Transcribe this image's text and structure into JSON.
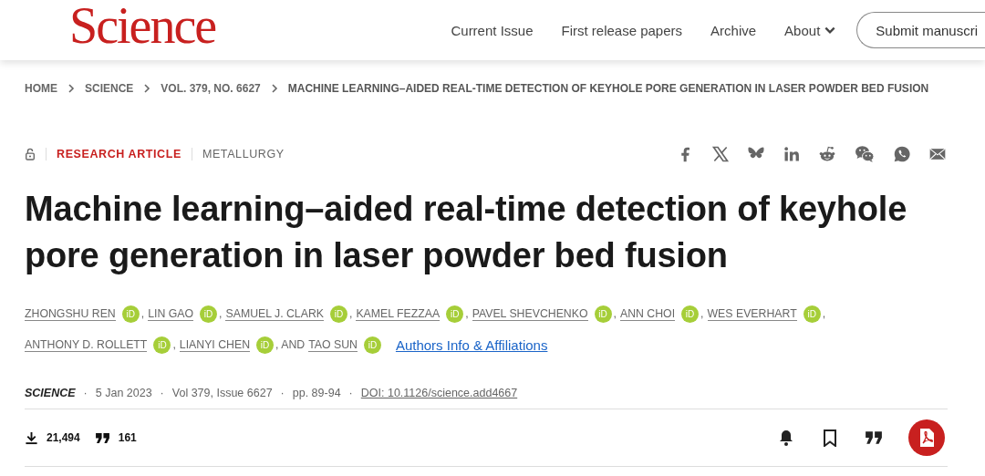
{
  "header": {
    "logo": "Science",
    "nav": [
      {
        "label": "Current Issue",
        "kind": "link"
      },
      {
        "label": "First release papers",
        "kind": "link"
      },
      {
        "label": "Archive",
        "kind": "link"
      },
      {
        "label": "About",
        "kind": "menu"
      }
    ],
    "submit_button": "Submit manuscri"
  },
  "breadcrumb": [
    "HOME",
    "SCIENCE",
    "VOL. 379, NO. 6627",
    "MACHINE LEARNING–AIDED REAL-TIME DETECTION OF KEYHOLE PORE GENERATION IN LASER POWDER BED FUSION"
  ],
  "article": {
    "locked": false,
    "type": "RESEARCH ARTICLE",
    "subject": "METALLURGY",
    "share": [
      {
        "kind": "facebook"
      },
      {
        "kind": "x"
      },
      {
        "kind": "bluesky"
      },
      {
        "kind": "linkedin"
      },
      {
        "kind": "reddit"
      },
      {
        "kind": "wechat"
      },
      {
        "kind": "whatsapp"
      },
      {
        "kind": "email"
      }
    ],
    "title": "Machine learning–aided real-time detection of keyhole pore generation in laser powder bed fusion",
    "authors": [
      {
        "name": "ZHONGSHU REN",
        "badge": "iD",
        "separator": ","
      },
      {
        "name": "LIN GAO",
        "badge": "iD",
        "separator": ","
      },
      {
        "name": "SAMUEL J. CLARK",
        "badge": "iD",
        "separator": ","
      },
      {
        "name": "KAMEL FEZZAA",
        "badge": "iD",
        "separator": ","
      },
      {
        "name": "PAVEL SHEVCHENKO",
        "badge": "iD",
        "separator": ","
      },
      {
        "name": "ANN CHOI",
        "badge": "iD",
        "separator": ","
      },
      {
        "name": "WES EVERHART",
        "badge": "iD",
        "separator": ","
      },
      {
        "name": "ANTHONY D. ROLLETT",
        "badge": "iD",
        "separator": ","
      },
      {
        "name": "LIANYI CHEN",
        "badge": "iD",
        "separator": ", AND"
      },
      {
        "name": "TAO SUN",
        "badge": "iD"
      }
    ],
    "affiliations_link": "Authors Info & Affiliations",
    "meta": [
      {
        "kind": "journal",
        "text": "SCIENCE"
      },
      {
        "kind": "bullet",
        "text": "·"
      },
      {
        "kind": "plain",
        "text": "5 Jan 2023"
      },
      {
        "kind": "bullet",
        "text": "·"
      },
      {
        "kind": "plain",
        "text": "Vol 379, Issue 6627"
      },
      {
        "kind": "bullet",
        "text": "·"
      },
      {
        "kind": "plain",
        "text": "pp. 89-94"
      },
      {
        "kind": "bullet",
        "text": "·"
      },
      {
        "kind": "link",
        "text": "DOI: 10.1126/science.add4667"
      }
    ],
    "metrics": [
      {
        "kind": "downloads",
        "value": "21,494"
      },
      {
        "kind": "citations",
        "value": "161"
      }
    ],
    "actions": [
      {
        "kind": "alert"
      },
      {
        "kind": "bookmark"
      },
      {
        "kind": "cite"
      },
      {
        "kind": "pdf"
      }
    ]
  }
}
